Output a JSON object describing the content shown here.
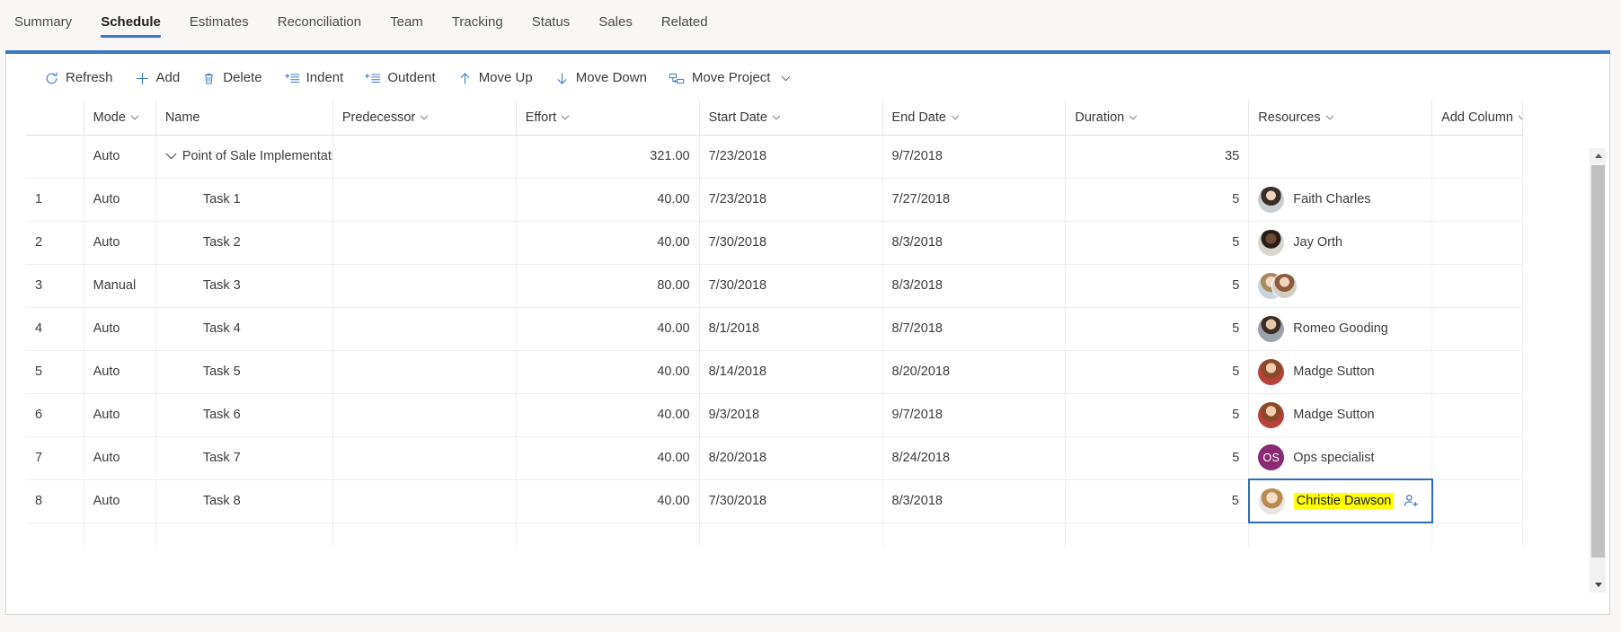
{
  "tabs": [
    {
      "label": "Summary",
      "active": false
    },
    {
      "label": "Schedule",
      "active": true
    },
    {
      "label": "Estimates",
      "active": false
    },
    {
      "label": "Reconciliation",
      "active": false
    },
    {
      "label": "Team",
      "active": false
    },
    {
      "label": "Tracking",
      "active": false
    },
    {
      "label": "Status",
      "active": false
    },
    {
      "label": "Sales",
      "active": false
    },
    {
      "label": "Related",
      "active": false
    }
  ],
  "toolbar": {
    "refresh_label": "Refresh",
    "add_label": "Add",
    "delete_label": "Delete",
    "indent_label": "Indent",
    "outdent_label": "Outdent",
    "move_up_label": "Move Up",
    "move_down_label": "Move Down",
    "move_project_label": "Move Project"
  },
  "grid": {
    "columns": [
      {
        "key": "rownum",
        "label": "",
        "sortable": false
      },
      {
        "key": "mode",
        "label": "Mode",
        "sortable": true
      },
      {
        "key": "name",
        "label": "Name",
        "sortable": false
      },
      {
        "key": "predecessor",
        "label": "Predecessor",
        "sortable": true
      },
      {
        "key": "effort",
        "label": "Effort",
        "sortable": true
      },
      {
        "key": "start_date",
        "label": "Start Date",
        "sortable": true
      },
      {
        "key": "end_date",
        "label": "End Date",
        "sortable": true
      },
      {
        "key": "duration",
        "label": "Duration",
        "sortable": true
      },
      {
        "key": "resources",
        "label": "Resources",
        "sortable": true
      },
      {
        "key": "add_column",
        "label": "Add Column",
        "sortable": true
      }
    ],
    "rows": [
      {
        "rownum": "",
        "mode": "Auto",
        "name": "Point of Sale Implementation",
        "summary": true,
        "expanded": true,
        "predecessor": "",
        "effort": "321.00",
        "start_date": "7/23/2018",
        "end_date": "9/7/2018",
        "duration": "35",
        "resources": [],
        "selected": false
      },
      {
        "rownum": "1",
        "mode": "Auto",
        "name": "Task 1",
        "summary": false,
        "predecessor": "",
        "effort": "40.00",
        "start_date": "7/23/2018",
        "end_date": "7/27/2018",
        "duration": "5",
        "resources": [
          {
            "name": "Faith Charles",
            "avatar": "photo-female-1",
            "initials": ""
          }
        ],
        "selected": false
      },
      {
        "rownum": "2",
        "mode": "Auto",
        "name": "Task 2",
        "summary": false,
        "predecessor": "",
        "effort": "40.00",
        "start_date": "7/30/2018",
        "end_date": "8/3/2018",
        "duration": "5",
        "resources": [
          {
            "name": "Jay Orth",
            "avatar": "photo-male-1",
            "initials": ""
          }
        ],
        "selected": false
      },
      {
        "rownum": "3",
        "mode": "Manual",
        "name": "Task 3",
        "summary": false,
        "predecessor": "",
        "effort": "80.00",
        "start_date": "7/30/2018",
        "end_date": "8/3/2018",
        "duration": "5",
        "resources": [
          {
            "name": "",
            "avatar": "photo-female-2",
            "initials": ""
          },
          {
            "name": "",
            "avatar": "photo-female-3",
            "initials": ""
          }
        ],
        "selected": false
      },
      {
        "rownum": "4",
        "mode": "Auto",
        "name": "Task 4",
        "summary": false,
        "predecessor": "",
        "effort": "40.00",
        "start_date": "8/1/2018",
        "end_date": "8/7/2018",
        "duration": "5",
        "resources": [
          {
            "name": "Romeo Gooding",
            "avatar": "photo-male-2",
            "initials": ""
          }
        ],
        "selected": false
      },
      {
        "rownum": "5",
        "mode": "Auto",
        "name": "Task 5",
        "summary": false,
        "predecessor": "",
        "effort": "40.00",
        "start_date": "8/14/2018",
        "end_date": "8/20/2018",
        "duration": "5",
        "resources": [
          {
            "name": "Madge Sutton",
            "avatar": "photo-female-4",
            "initials": ""
          }
        ],
        "selected": false
      },
      {
        "rownum": "6",
        "mode": "Auto",
        "name": "Task 6",
        "summary": false,
        "predecessor": "",
        "effort": "40.00",
        "start_date": "9/3/2018",
        "end_date": "9/7/2018",
        "duration": "5",
        "resources": [
          {
            "name": "Madge Sutton",
            "avatar": "photo-female-4",
            "initials": ""
          }
        ],
        "selected": false
      },
      {
        "rownum": "7",
        "mode": "Auto",
        "name": "Task 7",
        "summary": false,
        "predecessor": "",
        "effort": "40.00",
        "start_date": "8/20/2018",
        "end_date": "8/24/2018",
        "duration": "5",
        "resources": [
          {
            "name": "Ops specialist",
            "avatar": "initials",
            "initials": "OS"
          }
        ],
        "selected": false
      },
      {
        "rownum": "8",
        "mode": "Auto",
        "name": "Task 8",
        "summary": false,
        "predecessor": "",
        "effort": "40.00",
        "start_date": "7/30/2018",
        "end_date": "8/3/2018",
        "duration": "5",
        "resources": [
          {
            "name": "Christie Dawson",
            "avatar": "photo-female-5",
            "initials": ""
          }
        ],
        "selected": true,
        "highlight": true
      }
    ]
  },
  "colors": {
    "accent": "#3b78c3",
    "selection_border": "#2b6cb8",
    "highlight": "#ffff00",
    "initials_avatar": "#8a2a72",
    "panel_bg": "#ffffff",
    "page_bg": "#f8f7f6"
  },
  "scrollbar": {
    "up_icon": "caret-up-icon",
    "down_icon": "caret-down-icon"
  }
}
